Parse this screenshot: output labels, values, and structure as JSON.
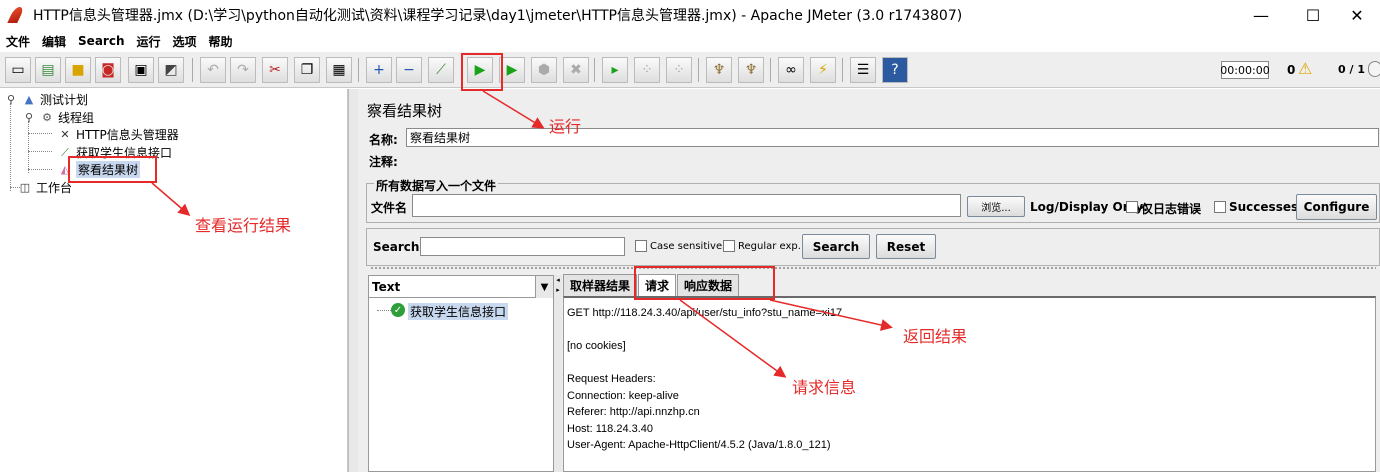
{
  "window": {
    "title": "HTTP信息头管理器.jmx (D:\\学习\\python自动化测试\\资料\\课程学习记录\\day1\\jmeter\\HTTP信息头管理器.jmx) - Apache JMeter (3.0 r1743807)",
    "minimize": "—",
    "maximize": "☐",
    "close": "✕"
  },
  "menu": [
    "文件",
    "编辑",
    "Search",
    "运行",
    "选项",
    "帮助"
  ],
  "toolbar": {
    "timer": "00:00:00",
    "warnings": "0",
    "threads": "0 / 1"
  },
  "tree": {
    "root": "测试计划",
    "thread_group": "线程组",
    "header_manager": "HTTP信息头管理器",
    "sampler": "获取学生信息接口",
    "listener": "察看结果树",
    "workbench": "工作台"
  },
  "panel": {
    "title": "察看结果树",
    "name_label": "名称:",
    "name_value": "察看结果树",
    "comment_label": "注释:",
    "file_group": "所有数据写入一个文件",
    "file_label": "文件名",
    "browse": "浏览...",
    "log_display": "Log/Display Only:",
    "errors_only": "仅日志错误",
    "successes": "Successes",
    "configure": "Configure",
    "search_label": "Search:",
    "case_sensitive": "Case sensitive",
    "regex": "Regular exp.",
    "search_btn": "Search",
    "reset_btn": "Reset"
  },
  "results": {
    "renderer": "Text",
    "sample_name": "获取学生信息接口",
    "tabs": [
      "取样器结果",
      "请求",
      "响应数据"
    ],
    "lines": [
      "GET http://118.24.3.40/api/user/stu_info?stu_name=xi17",
      "",
      "[no cookies]",
      "",
      "Request Headers:",
      "Connection: keep-alive",
      "Referer: http://api.nnzhp.cn",
      "Host: 118.24.3.40",
      "User-Agent: Apache-HttpClient/4.5.2 (Java/1.8.0_121)"
    ]
  },
  "annotations": {
    "run": "运行",
    "view_results": "查看运行结果",
    "response": "返回结果",
    "request_info": "请求信息"
  },
  "colors": {
    "annotation": "#e52a2a",
    "run_green": "#1aa31a"
  }
}
